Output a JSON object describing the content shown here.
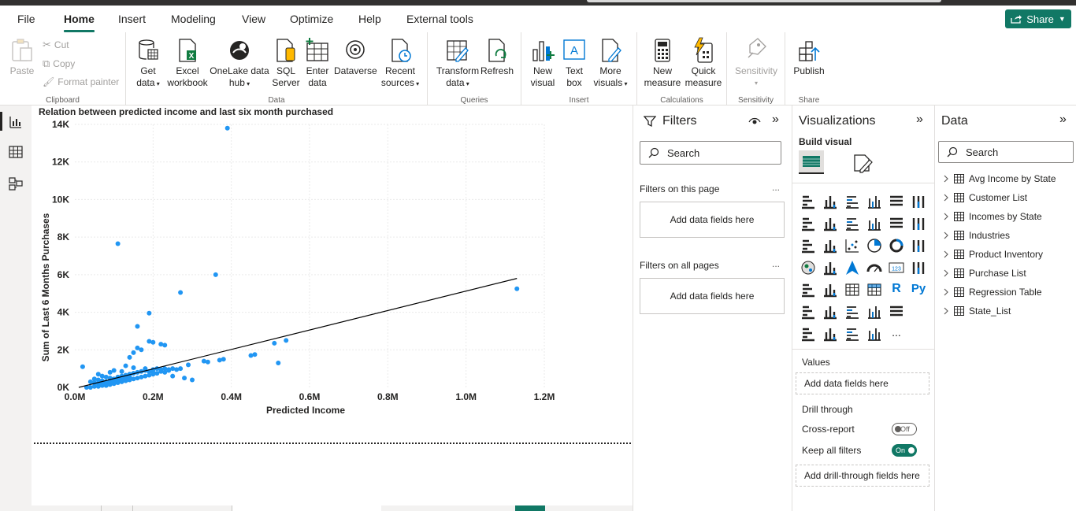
{
  "menu": {
    "tabs": [
      "File",
      "Home",
      "Insert",
      "Modeling",
      "View",
      "Optimize",
      "Help",
      "External tools"
    ],
    "active": "Home",
    "share_label": "Share"
  },
  "ribbon": {
    "clipboard": {
      "paste": "Paste",
      "cut": "Cut",
      "copy": "Copy",
      "format_painter": "Format painter",
      "label": "Clipboard"
    },
    "data": {
      "get_data": [
        "Get",
        "data"
      ],
      "excel": [
        "Excel",
        "workbook"
      ],
      "onelake": [
        "OneLake data",
        "hub"
      ],
      "sql": [
        "SQL",
        "Server"
      ],
      "enter": [
        "Enter",
        "data"
      ],
      "dataverse": [
        "Dataverse"
      ],
      "recent": [
        "Recent",
        "sources"
      ],
      "label": "Data"
    },
    "queries": {
      "transform": [
        "Transform",
        "data"
      ],
      "refresh": [
        "Refresh"
      ],
      "label": "Queries"
    },
    "insert": {
      "new_visual": [
        "New",
        "visual"
      ],
      "text_box": [
        "Text",
        "box"
      ],
      "more_visuals": [
        "More",
        "visuals"
      ],
      "label": "Insert"
    },
    "calculations": {
      "new_measure": [
        "New",
        "measure"
      ],
      "quick_measure": [
        "Quick",
        "measure"
      ],
      "label": "Calculations"
    },
    "sensitivity": {
      "btn": [
        "Sensitivity"
      ],
      "label": "Sensitivity"
    },
    "share": {
      "publish": [
        "Publish"
      ],
      "label": "Share"
    }
  },
  "chart_data": {
    "type": "scatter",
    "title": "Relation between predicted income and last six month purchased",
    "xlabel": "Predicted Income",
    "ylabel": "Sum of Last 6 Months Purchases",
    "xlim": [
      0,
      1.2
    ],
    "ylim": [
      0,
      14
    ],
    "x_ticks": [
      "0.0M",
      "0.2M",
      "0.4M",
      "0.6M",
      "0.8M",
      "1.0M",
      "1.2M"
    ],
    "y_ticks": [
      "0K",
      "2K",
      "4K",
      "6K",
      "8K",
      "10K",
      "12K",
      "14K"
    ],
    "x_units": "M",
    "y_units": "K",
    "point_color": "#2196f3",
    "trend_color": "#000000",
    "trendline": {
      "x": [
        0.01,
        1.13
      ],
      "y": [
        0.0,
        5.8
      ]
    },
    "points": [
      [
        0.39,
        13.8
      ],
      [
        0.11,
        7.65
      ],
      [
        0.36,
        6.0
      ],
      [
        1.13,
        5.25
      ],
      [
        0.27,
        5.05
      ],
      [
        0.19,
        3.95
      ],
      [
        0.16,
        3.25
      ],
      [
        0.19,
        2.45
      ],
      [
        0.2,
        2.4
      ],
      [
        0.23,
        2.25
      ],
      [
        0.22,
        2.3
      ],
      [
        0.54,
        2.5
      ],
      [
        0.51,
        2.35
      ],
      [
        0.46,
        1.75
      ],
      [
        0.45,
        1.7
      ],
      [
        0.52,
        1.3
      ],
      [
        0.17,
        2.0
      ],
      [
        0.16,
        2.1
      ],
      [
        0.15,
        1.85
      ],
      [
        0.14,
        1.6
      ],
      [
        0.38,
        1.5
      ],
      [
        0.37,
        1.45
      ],
      [
        0.33,
        1.4
      ],
      [
        0.34,
        1.35
      ],
      [
        0.29,
        1.2
      ],
      [
        0.27,
        1.0
      ],
      [
        0.26,
        0.95
      ],
      [
        0.24,
        0.9
      ],
      [
        0.22,
        0.85
      ],
      [
        0.23,
        0.8
      ],
      [
        0.21,
        0.75
      ],
      [
        0.2,
        0.7
      ],
      [
        0.19,
        0.65
      ],
      [
        0.18,
        0.6
      ],
      [
        0.17,
        0.55
      ],
      [
        0.16,
        0.5
      ],
      [
        0.15,
        0.45
      ],
      [
        0.14,
        0.4
      ],
      [
        0.13,
        0.35
      ],
      [
        0.12,
        0.3
      ],
      [
        0.11,
        0.25
      ],
      [
        0.1,
        0.2
      ],
      [
        0.09,
        0.15
      ],
      [
        0.08,
        0.1
      ],
      [
        0.07,
        0.1
      ],
      [
        0.06,
        0.05
      ],
      [
        0.05,
        0.05
      ],
      [
        0.04,
        0.0
      ],
      [
        0.03,
        0.0
      ],
      [
        0.02,
        1.1
      ],
      [
        0.13,
        1.15
      ],
      [
        0.1,
        0.9
      ],
      [
        0.12,
        0.85
      ],
      [
        0.09,
        0.8
      ],
      [
        0.15,
        1.05
      ],
      [
        0.18,
        1.0
      ],
      [
        0.2,
        0.95
      ],
      [
        0.25,
        0.6
      ],
      [
        0.28,
        0.5
      ],
      [
        0.3,
        0.4
      ],
      [
        0.06,
        0.7
      ],
      [
        0.07,
        0.6
      ],
      [
        0.08,
        0.55
      ],
      [
        0.09,
        0.5
      ],
      [
        0.1,
        0.45
      ],
      [
        0.11,
        0.55
      ],
      [
        0.12,
        0.6
      ],
      [
        0.13,
        0.65
      ],
      [
        0.14,
        0.7
      ],
      [
        0.15,
        0.75
      ],
      [
        0.16,
        0.8
      ],
      [
        0.17,
        0.85
      ],
      [
        0.18,
        0.9
      ],
      [
        0.19,
        0.85
      ],
      [
        0.2,
        0.8
      ],
      [
        0.05,
        0.45
      ],
      [
        0.06,
        0.4
      ],
      [
        0.07,
        0.35
      ],
      [
        0.08,
        0.3
      ],
      [
        0.09,
        0.3
      ],
      [
        0.1,
        0.35
      ],
      [
        0.11,
        0.4
      ],
      [
        0.12,
        0.45
      ],
      [
        0.13,
        0.5
      ],
      [
        0.14,
        0.55
      ],
      [
        0.04,
        0.3
      ],
      [
        0.05,
        0.25
      ],
      [
        0.06,
        0.2
      ],
      [
        0.07,
        0.2
      ],
      [
        0.08,
        0.25
      ],
      [
        0.21,
        1.0
      ],
      [
        0.22,
        0.95
      ],
      [
        0.23,
        1.0
      ],
      [
        0.24,
        0.95
      ],
      [
        0.25,
        1.0
      ]
    ]
  },
  "filters": {
    "title": "Filters",
    "search_placeholder": "Search",
    "on_this_page": "Filters on this page",
    "on_all_pages": "Filters on all pages",
    "add_fields": "Add data fields here",
    "ellipsis": "..."
  },
  "viz": {
    "title": "Visualizations",
    "build_visual": "Build visual",
    "values": "Values",
    "add_data_fields": "Add data fields here",
    "drill_through": "Drill through",
    "cross_report": "Cross-report",
    "cross_report_state": "Off",
    "keep_all_filters": "Keep all filters",
    "keep_all_filters_state": "On",
    "add_drill_fields": "Add drill-through fields here",
    "r_label": "R",
    "py_label": "Py",
    "more": "..."
  },
  "datapane": {
    "title": "Data",
    "search_placeholder": "Search",
    "tables": [
      "Avg Income by State",
      "Customer List",
      "Incomes by State",
      "Industries",
      "Product Inventory",
      "Purchase List",
      "Regression Table",
      "State_List"
    ]
  }
}
